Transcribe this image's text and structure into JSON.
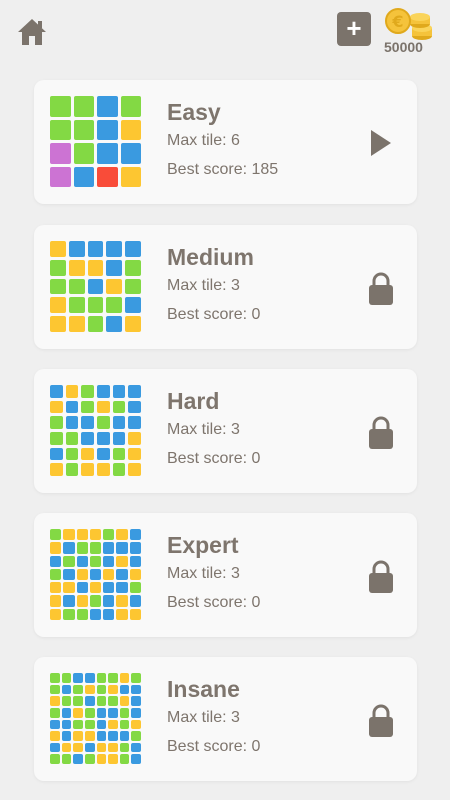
{
  "header": {
    "add_label": "+",
    "coins": "50000"
  },
  "colors": {
    "green": "#83d944",
    "blue": "#3a9ae0",
    "yellow": "#fdc631",
    "purple": "#cc73d3",
    "red": "#f94c39",
    "icon": "#7b736b"
  },
  "labels": {
    "max_tile": "Max tile: ",
    "best_score": "Best score: "
  },
  "levels": [
    {
      "name": "Easy",
      "max_tile": "Max tile: 6",
      "best_score": "Best score: 185",
      "locked": false,
      "size": 4,
      "pattern": [
        "GGBG",
        "GGBY",
        "PGBB",
        "PBRY"
      ]
    },
    {
      "name": "Medium",
      "max_tile": "Max tile: 3",
      "best_score": "Best score: 0",
      "locked": true,
      "size": 5,
      "pattern": [
        "YBBBB",
        "GYYBG",
        "GGBYG",
        "YGGGB",
        "YYGBY"
      ]
    },
    {
      "name": "Hard",
      "max_tile": "Max tile: 3",
      "best_score": "Best score: 0",
      "locked": true,
      "size": 6,
      "pattern": [
        "BYGBBB",
        "YBGYGB",
        "GBBGBB",
        "GGBBBY",
        "BGYBGY",
        "YGYYGY"
      ]
    },
    {
      "name": "Expert",
      "max_tile": "Max tile: 3",
      "best_score": "Best score: 0",
      "locked": true,
      "size": 7,
      "pattern": [
        "GYYYGYB",
        "YBGGBBB",
        "BGBGBYB",
        "GBYBYBY",
        "YYBYBBG",
        "YBYGBYB",
        "YGGBBYY"
      ]
    },
    {
      "name": "Insane",
      "max_tile": "Max tile: 3",
      "best_score": "Best score: 0",
      "locked": true,
      "size": 8,
      "pattern": [
        "GGBBGGYG",
        "GBGYGYBB",
        "YGGBGGYB",
        "GBYGBBGB",
        "BBGGBYGY",
        "YBYYBBBG",
        "BYYBYYGB",
        "GGBGYYGB"
      ]
    }
  ]
}
